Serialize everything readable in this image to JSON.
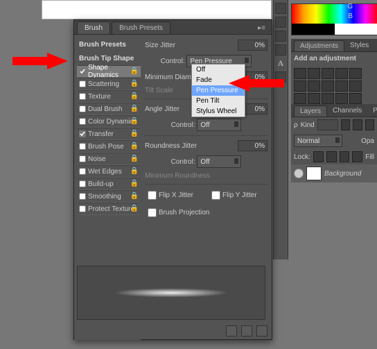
{
  "tabs": {
    "brush": "Brush",
    "brush_presets": "Brush Presets"
  },
  "side": {
    "title": "Brush Presets",
    "tipshape": "Brush Tip Shape",
    "items": [
      "Shape Dynamics",
      "Scattering",
      "Texture",
      "Dual Brush",
      "Color Dynamics",
      "Transfer",
      "Brush Pose",
      "Noise",
      "Wet Edges",
      "Build-up",
      "Smoothing",
      "Protect Texture"
    ]
  },
  "main": {
    "size_jitter": "Size Jitter",
    "size_pct": "0%",
    "control": "Control:",
    "control_val": "Pen Pressure",
    "min_diam": "Minimum Diameter",
    "min_pct": "0%",
    "tilt_scale": "Tilt Scale",
    "angle_jitter": "Angle Jitter",
    "angle_pct": "0%",
    "control2_val": "Off",
    "round_jitter": "Roundness Jitter",
    "round_pct": "0%",
    "control3_val": "Off",
    "min_round": "Minimum Roundness",
    "flipx": "Flip X Jitter",
    "flipy": "Flip Y Jitter",
    "brush_proj": "Brush Projection"
  },
  "dropdown": [
    "Off",
    "Fade",
    "Pen Pressure",
    "Pen Tilt",
    "Stylus Wheel"
  ],
  "dropdown_selected": 2,
  "adjustments": {
    "tab_adj": "Adjustments",
    "tab_styles": "Styles",
    "title": "Add an adjustment"
  },
  "layers": {
    "tab_layers": "Layers",
    "tab_channels": "Channels",
    "tab_paths": "Paths",
    "kind": "Kind",
    "mode": "Normal",
    "opacity": "Opa",
    "lock": "Lock:",
    "fill": "Fill",
    "layer1": "Background"
  },
  "rgb": {
    "g": "G",
    "b": "B"
  }
}
